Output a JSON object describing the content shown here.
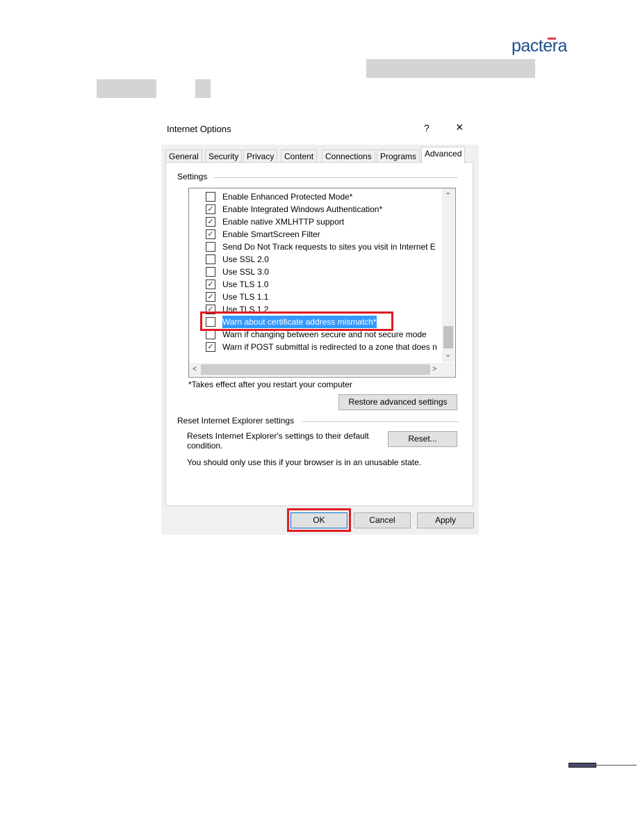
{
  "header": {
    "logo_text": "pactera"
  },
  "dialog": {
    "title": "Internet Options",
    "help_icon": "?",
    "close_icon": "×",
    "tabs": [
      {
        "label": "General"
      },
      {
        "label": "Security"
      },
      {
        "label": "Privacy"
      },
      {
        "label": "Content"
      },
      {
        "label": "Connections"
      },
      {
        "label": "Programs"
      },
      {
        "label": "Advanced",
        "active": true
      }
    ],
    "settings_label": "Settings",
    "items": [
      {
        "label": "Enable Enhanced Protected Mode*",
        "checked": false
      },
      {
        "label": "Enable Integrated Windows Authentication*",
        "checked": true
      },
      {
        "label": "Enable native XMLHTTP support",
        "checked": true
      },
      {
        "label": "Enable SmartScreen Filter",
        "checked": true
      },
      {
        "label": "Send Do Not Track requests to sites you visit in Internet E",
        "checked": false
      },
      {
        "label": "Use SSL 2.0",
        "checked": false
      },
      {
        "label": "Use SSL 3.0",
        "checked": false
      },
      {
        "label": "Use TLS 1.0",
        "checked": true
      },
      {
        "label": "Use TLS 1.1",
        "checked": true
      },
      {
        "label": "Use TLS 1.2",
        "checked": true
      },
      {
        "label": "Warn about certificate address mismatch*",
        "checked": false,
        "selected": true
      },
      {
        "label": "Warn if changing between secure and not secure mode",
        "checked": false
      },
      {
        "label": "Warn if POST submittal is redirected to a zone that does n",
        "checked": true
      }
    ],
    "restart_note": "*Takes effect after you restart your computer",
    "restore_button": "Restore advanced settings",
    "reset_group_label": "Reset Internet Explorer settings",
    "reset_desc_1": "Resets Internet Explorer's settings to their default",
    "reset_desc_2": "condition.",
    "reset_button": "Reset...",
    "reset_warning": "You should only use this if your browser is in an unusable state.",
    "ok_button": "OK",
    "cancel_button": "Cancel",
    "apply_button": "Apply",
    "highlight_color": "#e01b24",
    "selection_color": "#3399ff"
  }
}
